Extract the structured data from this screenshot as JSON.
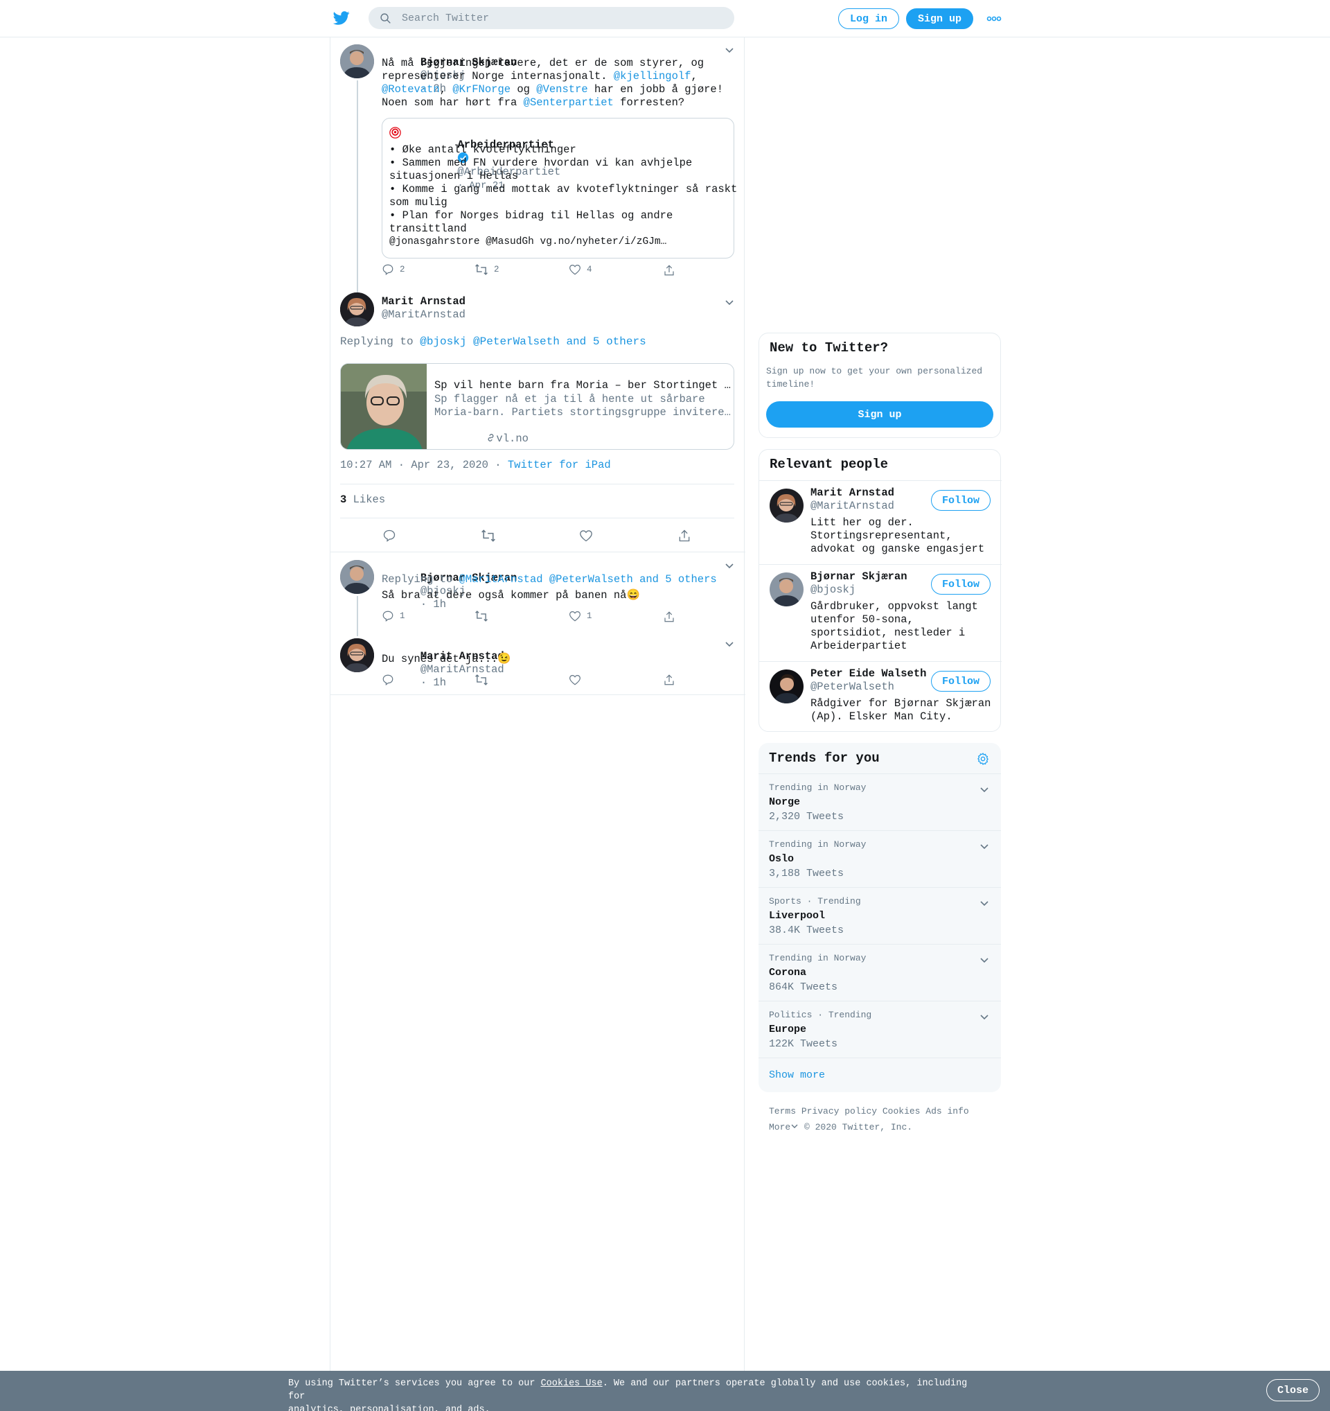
{
  "header": {
    "search_placeholder": "Search Twitter",
    "login_label": "Log in",
    "signup_label": "Sign up"
  },
  "tweet1": {
    "name": "Bjørnar Skjæran",
    "handle": "@bjoskj",
    "time": "· 2h",
    "text": {
      "l1": "Nå må regjeringen levere, det er de som styrer, og",
      "l2a": "representerer Norge internasjonalt. ",
      "l2m": "@kjellingolf",
      "l2b": ",",
      "l3m1": "@Rotevatn",
      "l3s1": ", ",
      "l3m2": "@KrFNorge",
      "l3s2": " og ",
      "l3m3": "@Venstre",
      "l3s3": " har en jobb å gjøre!",
      "l4a": "Noen som har hørt fra ",
      "l4m": "@Senterpartiet",
      "l4b": " forresten?"
    },
    "quote": {
      "name": "Arbeiderpartiet",
      "handle": "@Arbeiderpartiet",
      "time": "· Apr 21",
      "lines": [
        "• Øke antall kvoteflyktninger",
        "• Sammen med FN vurdere hvordan vi kan avhjelpe",
        "situasjonen i Hellas",
        "• Komme i gang med mottak av kvoteflyktninger så raskt",
        "som mulig",
        "• Plan for Norges bidrag til Hellas og andre",
        "transittland",
        "@jonasgahrstore @MasudGh vg.no/nyheter/i/zGJm…"
      ]
    },
    "replies": "2",
    "retweets": "2",
    "likes": "4"
  },
  "main_tweet": {
    "name": "Marit Arnstad",
    "handle": "@MaritArnstad",
    "replying_prefix": "Replying to ",
    "replying_to": "@bjoskj @PeterWalseth and 5 others",
    "card": {
      "title": "Sp vil hente barn fra Moria – ber Stortinget …",
      "desc1": "Sp flagger nå et ja til å hente ut sårbare",
      "desc2": "Moria-barn. Partiets stortingsgruppe invitere…",
      "domain": "vl.no"
    },
    "timestamp": "10:27 AM · Apr 23, 2020 · ",
    "source": "Twitter for iPad",
    "likes_count": "3",
    "likes_label": " Likes"
  },
  "reply1": {
    "name": "Bjørnar Skjæran",
    "handle": "@bjoskj",
    "time": "· 1h",
    "replying_prefix": "Replying to ",
    "replying_to": "@MaritArnstad @PeterWalseth and 5 others",
    "text": "Så bra at dere også kommer på banen nå😄",
    "replies": "1",
    "likes": "1"
  },
  "reply2": {
    "name": "Marit Arnstad",
    "handle": "@MaritArnstad",
    "time": "· 1h",
    "text": "Du synes det ja...😉"
  },
  "new_to_twitter": {
    "title": "New to Twitter?",
    "desc1": "Sign up now to get your own personalized",
    "desc2": "timeline!",
    "button": "Sign up"
  },
  "relevant_people": {
    "title": "Relevant people",
    "follow_label": "Follow",
    "people": [
      {
        "name": "Marit Arnstad",
        "handle": "@MaritArnstad",
        "bio": [
          "Litt her og der.",
          "Stortingsrepresentant,",
          "advokat og ganske engasjert"
        ]
      },
      {
        "name": "Bjørnar Skjæran",
        "handle": "@bjoskj",
        "bio": [
          "Gårdbruker, oppvokst langt",
          "utenfor 50-sona,",
          "sportsidiot, nestleder i",
          "Arbeiderpartiet"
        ]
      },
      {
        "name": "Peter Eide Walseth",
        "handle": "@PeterWalseth",
        "bio": [
          "Rådgiver for Bjørnar Skjæran",
          "(Ap). Elsker Man City."
        ]
      }
    ]
  },
  "trends": {
    "title": "Trends for you",
    "items": [
      {
        "context": "Trending in Norway",
        "name": "Norge",
        "count": "2,320 Tweets"
      },
      {
        "context": "Trending in Norway",
        "name": "Oslo",
        "count": "3,188 Tweets"
      },
      {
        "context": "Sports · Trending",
        "name": "Liverpool",
        "count": "38.4K Tweets"
      },
      {
        "context": "Trending in Norway",
        "name": "Corona",
        "count": "864K Tweets"
      },
      {
        "context": "Politics · Trending",
        "name": "Europe",
        "count": "122K Tweets"
      }
    ],
    "show_more": "Show more"
  },
  "footer": {
    "terms": "Terms",
    "privacy": "Privacy policy",
    "cookies": "Cookies",
    "ads": "Ads info",
    "more": "More",
    "copyright": "© 2020 Twitter, Inc."
  },
  "cookie_bar": {
    "text1": "By using Twitter’s services you agree to our ",
    "link": "Cookies Use",
    "text2": ". We and our partners operate globally and use cookies, including for",
    "text3": "analytics, personalisation, and ads.",
    "close": "Close"
  },
  "colors": {
    "brand": "#1da1f2",
    "link": "#1b95e0",
    "muted": "#657786",
    "cookie_bg": "#657786"
  }
}
